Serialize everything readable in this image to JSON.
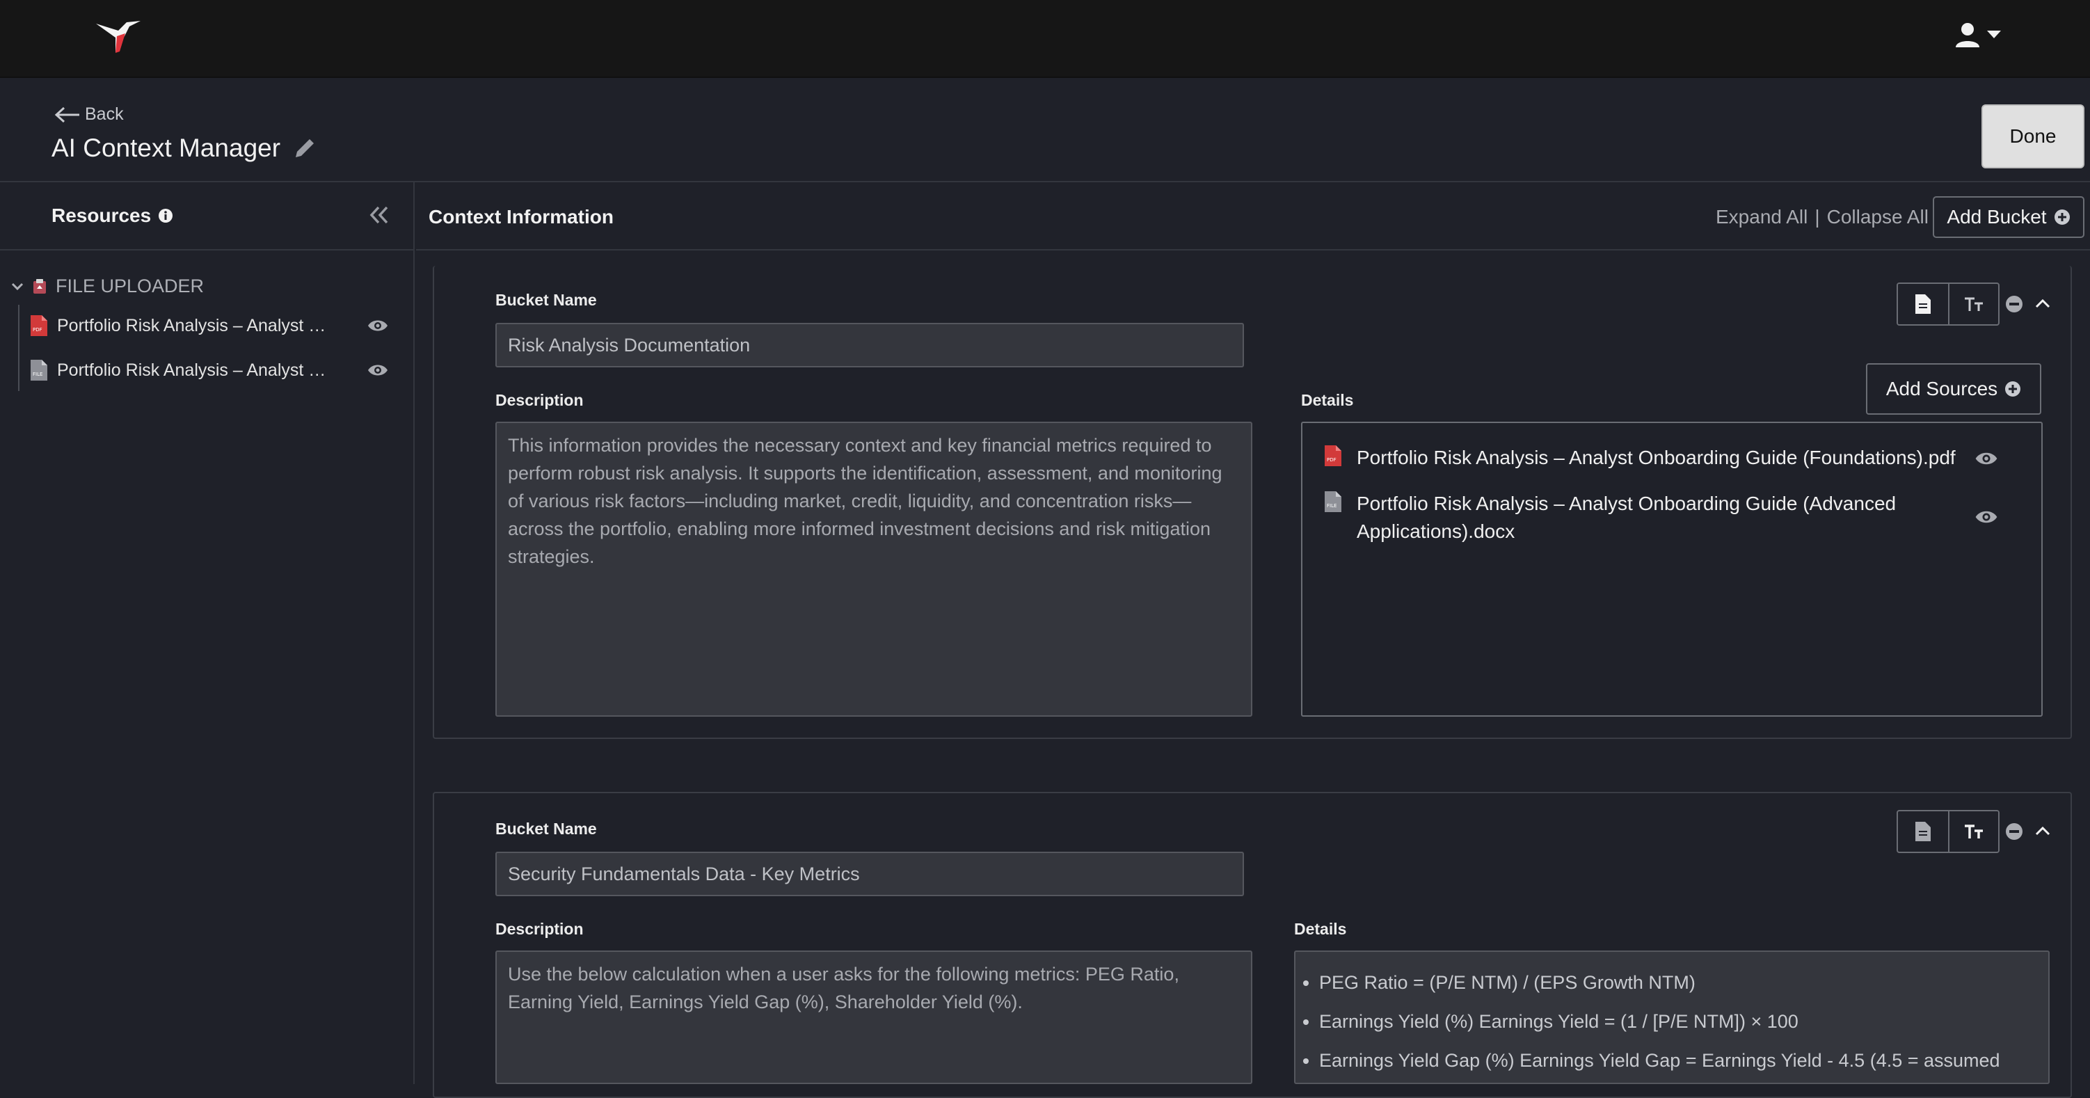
{
  "header": {
    "back_label": "Back",
    "title": "AI Context Manager",
    "done_label": "Done"
  },
  "sidebar": {
    "title": "Resources",
    "group": "FILE UPLOADER",
    "files": [
      {
        "label": "Portfolio Risk Analysis – Analyst Onboarding Guide (Foundations).pdf",
        "icon": "pdf-file-icon"
      },
      {
        "label": "Portfolio Risk Analysis – Analyst Onboarding Guide (Advanced Applications).docx",
        "icon": "generic-file-icon"
      }
    ]
  },
  "context": {
    "title": "Context Information",
    "expand_all": "Expand All",
    "collapse_all": "Collapse All",
    "divider": "|",
    "add_bucket": "Add Bucket"
  },
  "buckets": [
    {
      "name_label": "Bucket Name",
      "name_value": "Risk Analysis Documentation",
      "description_label": "Description",
      "description": "This information provides the necessary context and key financial metrics required to perform robust risk analysis. It supports the identification, assessment, and monitoring of various risk factors—including market, credit, liquidity, and concentration risks—across the portfolio, enabling more informed investment decisions and risk mitigation strategies.",
      "details_label": "Details",
      "add_sources": "Add Sources",
      "detail_files": [
        "Portfolio Risk Analysis – Analyst Onboarding Guide (Foundations).pdf",
        "Portfolio Risk Analysis – Analyst Onboarding Guide (Advanced Applications).docx"
      ]
    },
    {
      "name_label": "Bucket Name",
      "name_value": "Security Fundamentals Data - Key Metrics",
      "description_label": "Description",
      "description": "Use the below calculation when a user asks for the following metrics: PEG Ratio, Earning Yield, Earnings Yield Gap (%), Shareholder Yield (%).",
      "details_label": "Details",
      "detail_bullets": [
        "PEG Ratio = (P/E NTM) / (EPS Growth NTM)",
        "Earnings Yield (%) Earnings Yield = (1 / [P/E NTM]) × 100",
        "Earnings Yield Gap (%) Earnings Yield Gap = Earnings Yield - 4.5 (4.5 = assumed"
      ]
    }
  ],
  "colors": {
    "topbar": "#161616",
    "background": "#1f2129",
    "input_bg": "#34363d",
    "pdf_red": "#d23a3a",
    "logo_red": "#e0343c"
  }
}
